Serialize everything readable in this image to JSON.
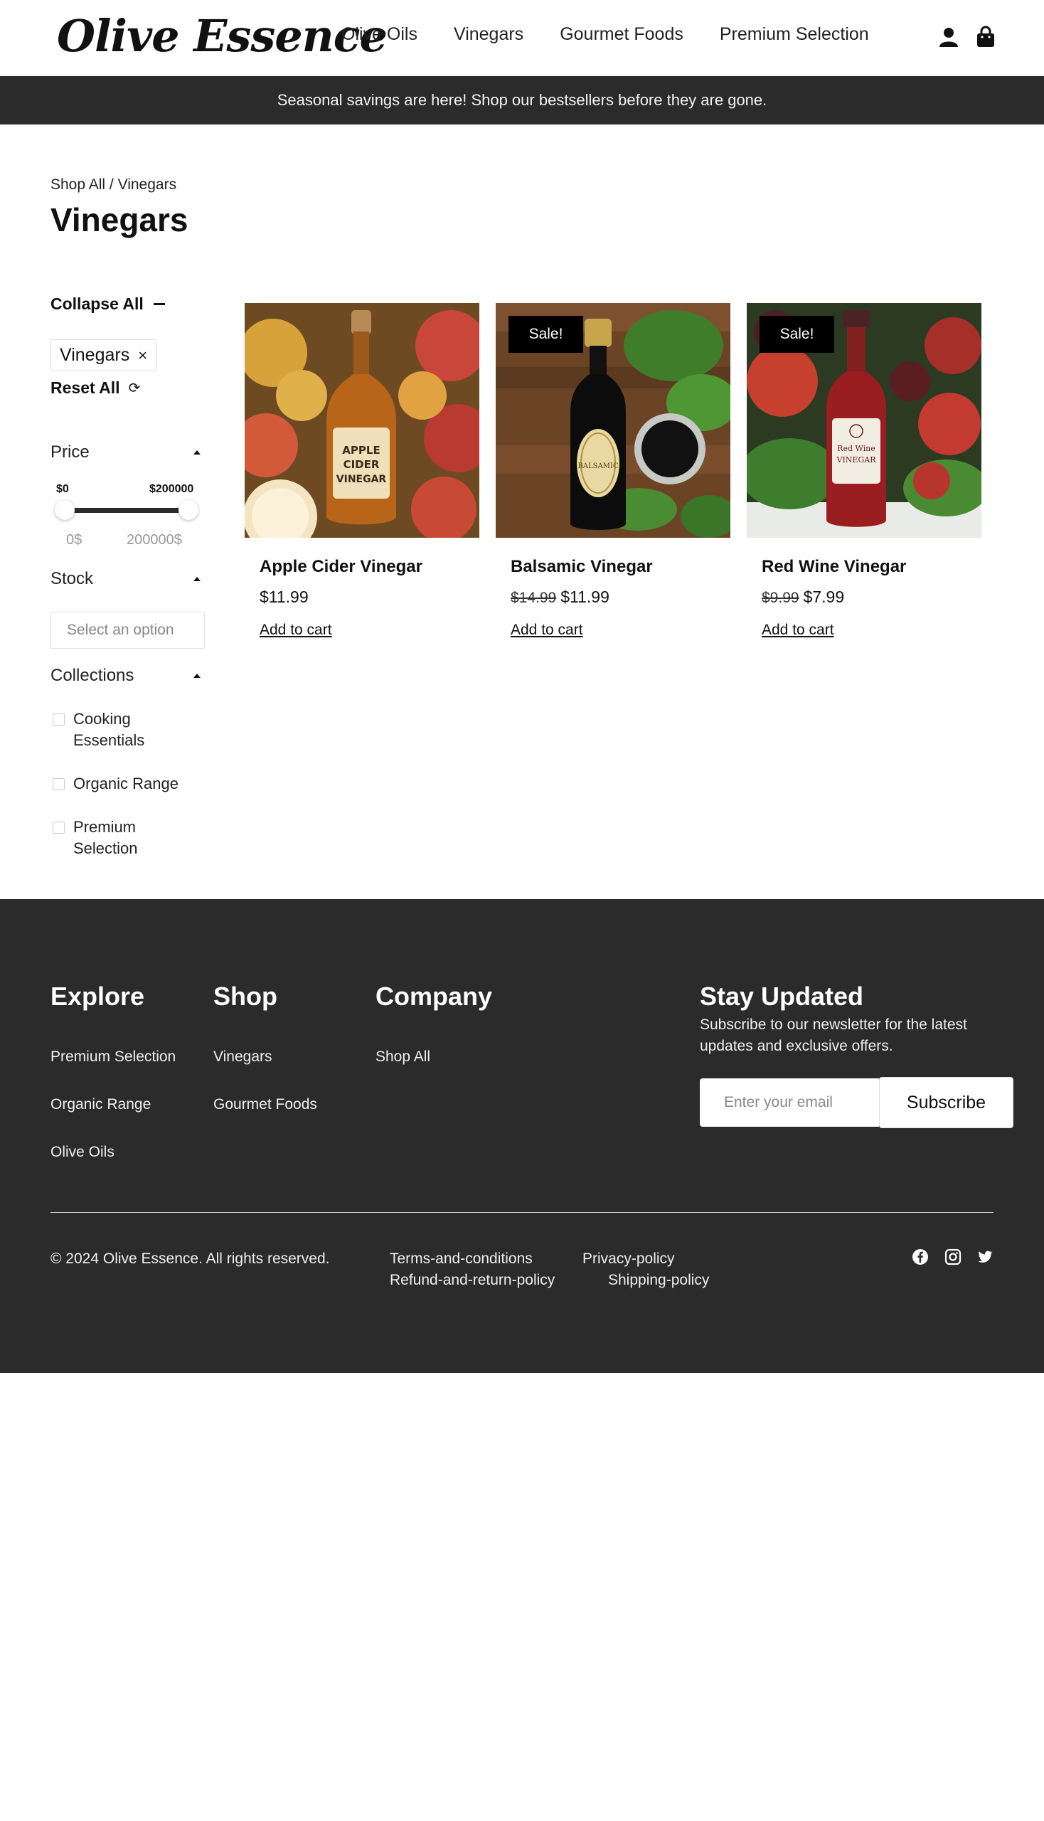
{
  "header": {
    "logo": "Olive Essence",
    "nav": [
      "Olive Oils",
      "Vinegars",
      "Gourmet Foods",
      "Premium Selection"
    ],
    "icons": [
      "user-icon",
      "shopping-bag-icon"
    ]
  },
  "announcement": "Seasonal savings are here! Shop our bestsellers before they are gone.",
  "breadcrumb": {
    "root": "Shop All",
    "sep": " / ",
    "current": "Vinegars"
  },
  "page_title": "Vinegars",
  "sidebar": {
    "collapse_all": "Collapse All",
    "active_filter": "Vinegars",
    "remove_glyph": "×",
    "reset_all": "Reset All",
    "reset_glyph": "⟳",
    "price": {
      "label": "Price",
      "min_label": "$0",
      "max_label": "$200000",
      "min_value": "0$",
      "max_value": "200000$",
      "selected_range": [
        0,
        200000
      ]
    },
    "stock": {
      "label": "Stock",
      "placeholder": "Select an option"
    },
    "collections": {
      "label": "Collections",
      "items": [
        "Cooking Essentials",
        "Organic Range",
        "Premium Selection"
      ]
    }
  },
  "products": [
    {
      "name": "Apple Cider Vinegar",
      "old_price": "",
      "price": "$11.99",
      "sale": false,
      "add_to_cart": "Add to cart"
    },
    {
      "name": "Balsamic Vinegar",
      "old_price": "$14.99",
      "price": "$11.99",
      "sale": true,
      "sale_label": "Sale!",
      "add_to_cart": "Add to cart"
    },
    {
      "name": "Red Wine Vinegar",
      "old_price": "$9.99",
      "price": "$7.99",
      "sale": true,
      "sale_label": "Sale!",
      "add_to_cart": "Add to cart"
    }
  ],
  "footer": {
    "explore": {
      "title": "Explore",
      "links": [
        "Premium Selection",
        "Organic Range",
        "Olive Oils"
      ]
    },
    "shop": {
      "title": "Shop",
      "links": [
        "Vinegars",
        "Gourmet Foods"
      ]
    },
    "company": {
      "title": "Company",
      "links": [
        "Shop All"
      ]
    },
    "newsletter": {
      "title": "Stay Updated",
      "text": "Subscribe to our newsletter for the latest updates and exclusive offers.",
      "placeholder": "Enter your email",
      "button": "Subscribe"
    },
    "copyright": "© 2024 Olive Essence. All rights reserved.",
    "legal": [
      "Terms-and-conditions",
      "Privacy-policy",
      "Refund-and-return-policy",
      "Shipping-policy"
    ],
    "social": [
      "facebook-icon",
      "instagram-icon",
      "twitter-icon"
    ]
  },
  "colors": {
    "dark_band": "#2b2b2b",
    "text": "#111111",
    "sale_badge": "#000000"
  }
}
